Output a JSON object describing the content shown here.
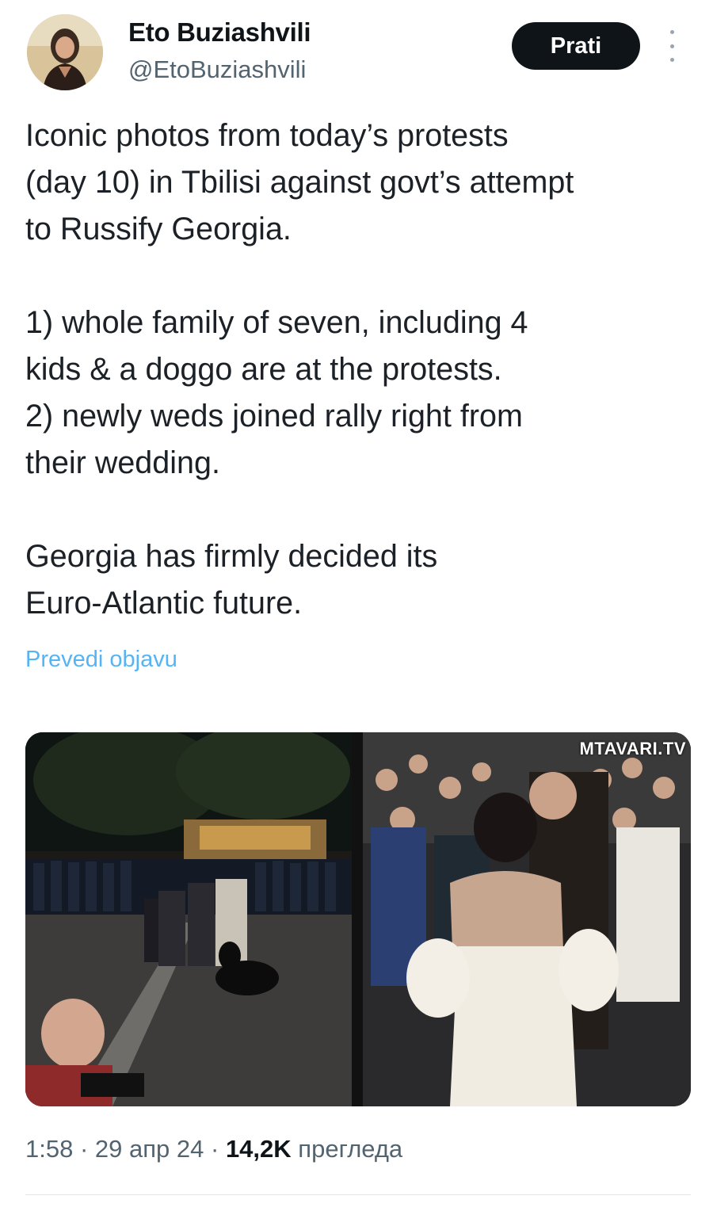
{
  "author": {
    "name": "Eto Buziashvili",
    "handle": "@EtoBuziashvili",
    "follow_label": "Prati"
  },
  "tweet": {
    "paragraph1": [
      "Iconic photos from today’s protests",
      "(day 10) in Tbilisi against govt’s attempt",
      "to Russify Georgia."
    ],
    "paragraph2": [
      "1) whole family of seven, including 4",
      "kids & a doggo are at the protests.",
      "2) newly weds joined rally right from",
      "their wedding."
    ],
    "paragraph3": [
      "Georgia has firmly decided its",
      "Euro-Atlantic future."
    ],
    "translate_label": "Prevedi objavu"
  },
  "media": {
    "watermark": "MTAVARI.TV"
  },
  "meta": {
    "time": "1:58",
    "date": "29 апр 24",
    "views_count": "14,2K",
    "views_label": "прегледа"
  },
  "colors": {
    "text": "#0f1419",
    "secondary": "#536471",
    "link": "#1d9bf0",
    "follow_bg": "#0f1419"
  }
}
